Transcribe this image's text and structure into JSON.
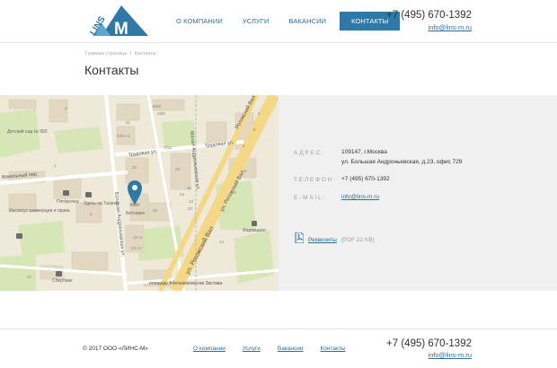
{
  "brand": {
    "logo_text": "LINS",
    "logo_letter": "M",
    "accent": "#2f79a6"
  },
  "nav": [
    {
      "label": "О компании",
      "active": false
    },
    {
      "label": "Услуги",
      "active": false
    },
    {
      "label": "Вакансии",
      "active": false
    },
    {
      "label": "Контакты",
      "active": true
    }
  ],
  "header": {
    "phone": "+7 (495) 670-1392",
    "email": "info@lins-m.ru"
  },
  "breadcrumb": {
    "home": "Главная страница",
    "separator": "/",
    "current": "Контакты"
  },
  "page_title": "Контакты",
  "map": {
    "street_labels": [
      "Трудовая ул.",
      "Трудовая ул.",
      "Факельный пер.",
      "Большая Андроньевская ул.",
      "Малая Андроньевская ул.",
      "ул. Рогожский Вал",
      "ул. Рогожский Вал",
      "площадь Абельмановская Застава",
      "Рогожский Вал"
    ],
    "poi_labels": [
      "Детский сад № 992",
      "Пятёрочка",
      "Здесь на Таганке",
      "Институт коммерции и права",
      "Сбербанк",
      "Фармацевт",
      "Бетховен"
    ],
    "building_numbers": [
      "23/5",
      "21",
      "23/6 с1",
      "3",
      "25/9",
      "22",
      "23",
      "7/13",
      "5",
      "25",
      "23 с1",
      "23 с2",
      "1",
      "16",
      "12",
      "20",
      "24",
      "4",
      "6",
      "10",
      "14",
      "2",
      "8",
      "17"
    ],
    "marker_icon": "map-pin-icon"
  },
  "contacts": {
    "address_label": "Адрес:",
    "address_line1": "109147, г.Москва",
    "address_line2": "ул. Большая Андроньевская, д.23, офис 729",
    "phone_label": "Телефон:",
    "phone": "+7 (495) 670-1392",
    "email_label": "E-mail:",
    "email": "info@lins-m.ru",
    "requisites_icon": "pdf-icon",
    "requisites_label": "Реквизиты",
    "requisites_meta": "(PDF 22 KB)"
  },
  "footer": {
    "copyright": "© 2017 ООО «ЛИНС-М»",
    "links": [
      "О компании",
      "Услуги",
      "Вакансии",
      "Контакты"
    ],
    "phone": "+7 (495) 670-1392",
    "email": "info@lins-m.ru"
  }
}
